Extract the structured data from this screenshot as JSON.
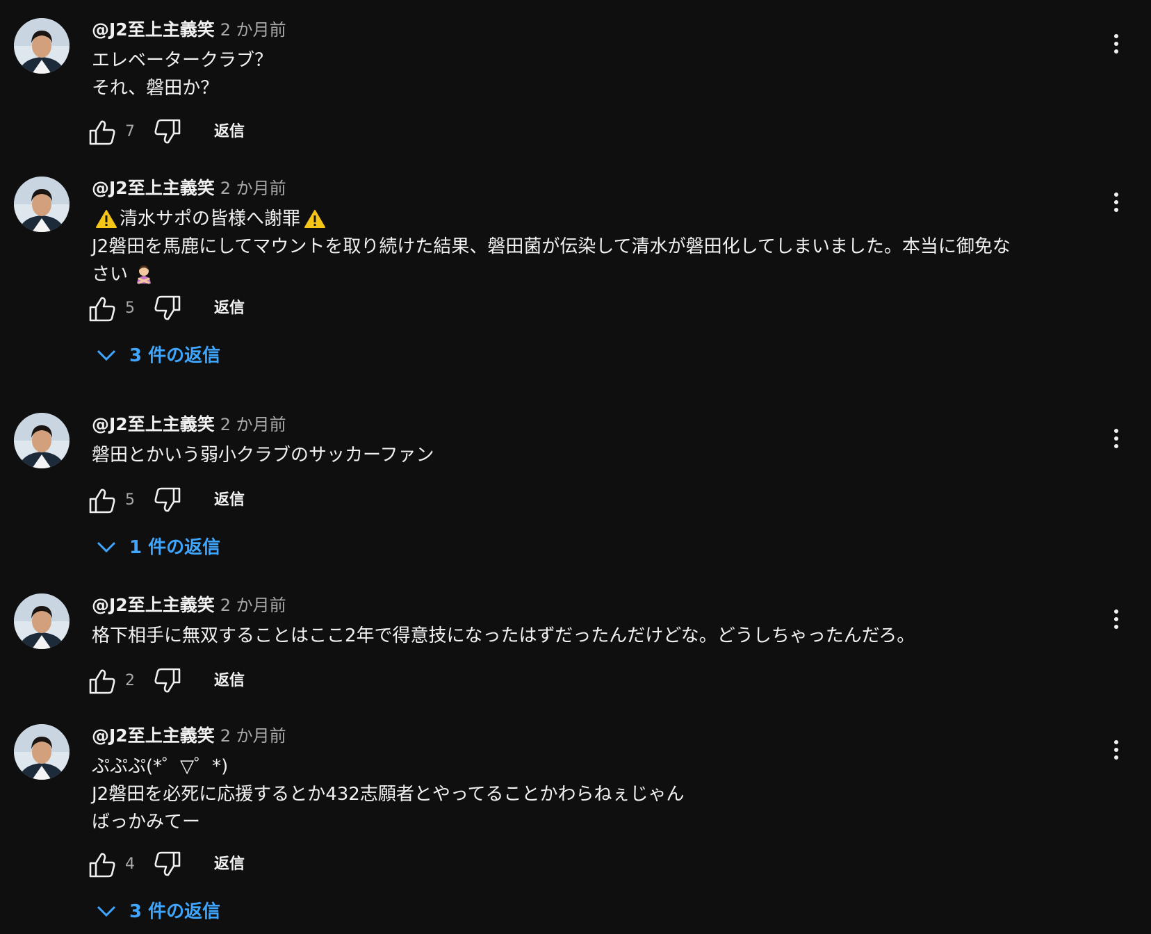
{
  "comments": [
    {
      "author": "@J2至上主義笑",
      "time": "2 か月前",
      "lines": [
        "エレベータークラブ？",
        "それ、磐田か？"
      ],
      "likes": "7",
      "reply_label": "返信",
      "replies_label": ""
    },
    {
      "author": "@J2至上主義笑",
      "time": "2 か月前",
      "lines": [
        "清水サポの皆様へ謝罪",
        "J2磐田を馬鹿にしてマウントを取り続けた結果、磐田菌が伝染して清水が磐田化してしまいました。本当に御免な",
        "さい"
      ],
      "likes": "5",
      "reply_label": "返信",
      "replies_label": "3 件の返信"
    },
    {
      "author": "@J2至上主義笑",
      "time": "2 か月前",
      "lines": [
        "磐田とかいう弱小クラブのサッカーファン"
      ],
      "likes": "5",
      "reply_label": "返信",
      "replies_label": "1 件の返信"
    },
    {
      "author": "@J2至上主義笑",
      "time": "2 か月前",
      "lines": [
        "格下相手に無双することはここ2年で得意技になったはずだったんだけどな。どうしちゃったんだろ。"
      ],
      "likes": "2",
      "reply_label": "返信",
      "replies_label": ""
    },
    {
      "author": "@J2至上主義笑",
      "time": "2 か月前",
      "lines": [
        "ぷぷぷ(*゜▽゜*)",
        "J2磐田を必死に応援するとか432志願者とやってることかわらねぇじゃん",
        "ばっかみてー"
      ],
      "likes": "4",
      "reply_label": "返信",
      "replies_label": "3 件の返信"
    }
  ],
  "icons": {
    "like": "thumbs-up-icon",
    "dislike": "thumbs-down-icon",
    "more": "vertical-dots-icon",
    "expand": "chevron-down-icon",
    "warning": "warning-emoji",
    "person": "person-gesturing-no-emoji"
  },
  "colors": {
    "background": "#0f0f0f",
    "text": "#f1f1f1",
    "muted": "#aaaaaa",
    "link": "#3ea6ff"
  }
}
